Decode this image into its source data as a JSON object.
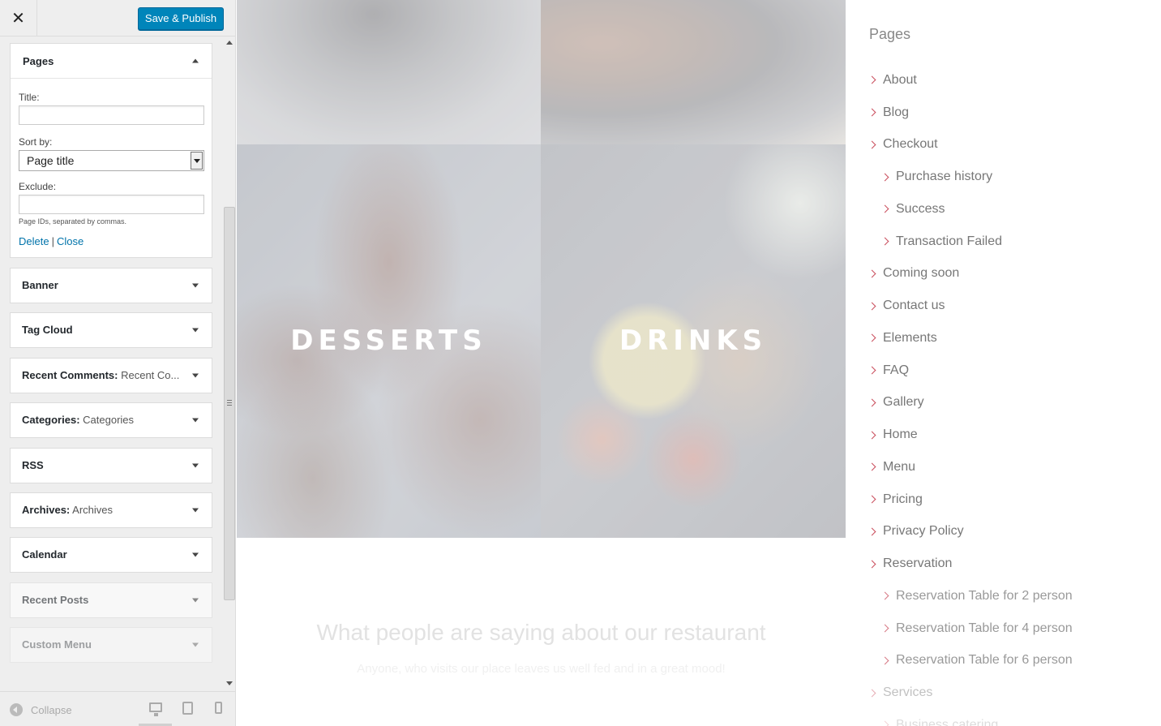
{
  "header": {
    "close_icon": "close-icon",
    "publish_label": "Save & Publish"
  },
  "pages_widget_form": {
    "title": "Pages",
    "title_label": "Title:",
    "title_value": "",
    "sort_label": "Sort by:",
    "sort_value": "Page title",
    "exclude_label": "Exclude:",
    "exclude_value": "",
    "exclude_help": "Page IDs, separated by commas.",
    "delete_label": "Delete",
    "separator": "|",
    "close_label": "Close"
  },
  "widgets": [
    {
      "title": "Banner",
      "subtitle": ""
    },
    {
      "title": "Tag Cloud",
      "subtitle": ""
    },
    {
      "title": "Recent Comments:",
      "subtitle": "Recent Co..."
    },
    {
      "title": "Categories:",
      "subtitle": "Categories"
    },
    {
      "title": "RSS",
      "subtitle": ""
    },
    {
      "title": "Archives:",
      "subtitle": "Archives"
    },
    {
      "title": "Calendar",
      "subtitle": ""
    },
    {
      "title": "Recent Posts",
      "subtitle": ""
    },
    {
      "title": "Custom Menu",
      "subtitle": ""
    }
  ],
  "footer": {
    "collapse_label": "Collapse",
    "devices": [
      "desktop-icon",
      "tablet-icon",
      "mobile-icon"
    ]
  },
  "preview": {
    "categories": [
      "DESSERTS",
      "DRINKS"
    ],
    "testimonials_title": "What people are saying about our restaurant",
    "testimonials_subtitle": "Anyone, who visits our place leaves us well fed and in a great mood!",
    "pages_heading": "Pages",
    "pages": [
      {
        "label": "About",
        "level": 0
      },
      {
        "label": "Blog",
        "level": 0
      },
      {
        "label": "Checkout",
        "level": 0
      },
      {
        "label": "Purchase history",
        "level": 1
      },
      {
        "label": "Success",
        "level": 1
      },
      {
        "label": "Transaction Failed",
        "level": 1
      },
      {
        "label": "Coming soon",
        "level": 0
      },
      {
        "label": "Contact us",
        "level": 0
      },
      {
        "label": "Elements",
        "level": 0
      },
      {
        "label": "FAQ",
        "level": 0
      },
      {
        "label": "Gallery",
        "level": 0
      },
      {
        "label": "Home",
        "level": 0
      },
      {
        "label": "Menu",
        "level": 0
      },
      {
        "label": "Pricing",
        "level": 0
      },
      {
        "label": "Privacy Policy",
        "level": 0
      },
      {
        "label": "Reservation",
        "level": 0
      },
      {
        "label": "Reservation Table for 2 person",
        "level": 1
      },
      {
        "label": "Reservation Table for 4 person",
        "level": 1
      },
      {
        "label": "Reservation Table for 6 person",
        "level": 1
      },
      {
        "label": "Services",
        "level": 0
      },
      {
        "label": "Business catering",
        "level": 1
      }
    ]
  },
  "colors": {
    "publish_button": "#0085ba",
    "link": "#0073aa",
    "page_chevron": "#c94c5b"
  }
}
